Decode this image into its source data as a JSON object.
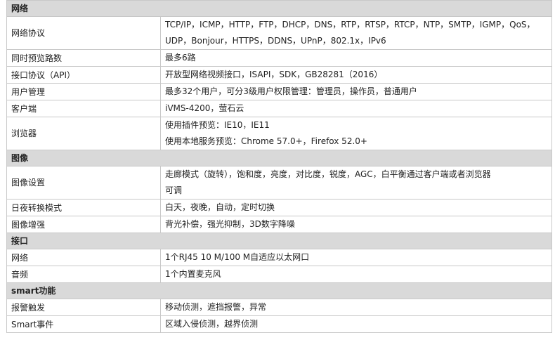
{
  "sections": [
    {
      "title": "网络",
      "rows": [
        {
          "label": "网络协议",
          "lines": [
            "TCP/IP，ICMP，HTTP，FTP，DHCP，DNS，RTP，RTSP，RTCP，NTP，SMTP，IGMP，QoS，",
            "UDP，Bonjour，HTTPS，DDNS，UPnP，802.1x，IPv6"
          ]
        },
        {
          "label": "同时预览路数",
          "lines": [
            "最多6路"
          ]
        },
        {
          "label": "接口协议（API）",
          "lines": [
            "开放型网络视频接口，ISAPI，SDK，GB28281（2016）"
          ]
        },
        {
          "label": "用户管理",
          "lines": [
            "最多32个用户，可分3级用户权限管理：管理员，操作员，普通用户"
          ]
        },
        {
          "label": "客户端",
          "lines": [
            "iVMS-4200，萤石云"
          ]
        },
        {
          "label": "浏览器",
          "lines": [
            "使用插件预览：IE10，IE11",
            "使用本地服务预览：Chrome 57.0+，Firefox 52.0+"
          ]
        }
      ]
    },
    {
      "title": "图像",
      "rows": [
        {
          "label": "图像设置",
          "lines": [
            "走廊模式（旋转），饱和度，亮度，对比度，锐度，AGC，白平衡通过客户端或者浏览器",
            "可调"
          ]
        },
        {
          "label": "日夜转换模式",
          "lines": [
            "白天，夜晚，自动，定时切换"
          ]
        },
        {
          "label": "图像增强",
          "lines": [
            "背光补偿，强光抑制，3D数字降噪"
          ]
        }
      ]
    },
    {
      "title": "接口",
      "rows": [
        {
          "label": "网络",
          "lines": [
            "1个RJ45 10 M/100 M自适应以太网口"
          ]
        },
        {
          "label": "音频",
          "lines": [
            "1个内置麦克风"
          ]
        }
      ]
    },
    {
      "title": "smart功能",
      "rows": [
        {
          "label": "报警触发",
          "lines": [
            "移动侦测，遮挡报警，异常"
          ]
        },
        {
          "label": "Smart事件",
          "lines": [
            "区域入侵侦测，越界侦测"
          ]
        }
      ]
    }
  ]
}
